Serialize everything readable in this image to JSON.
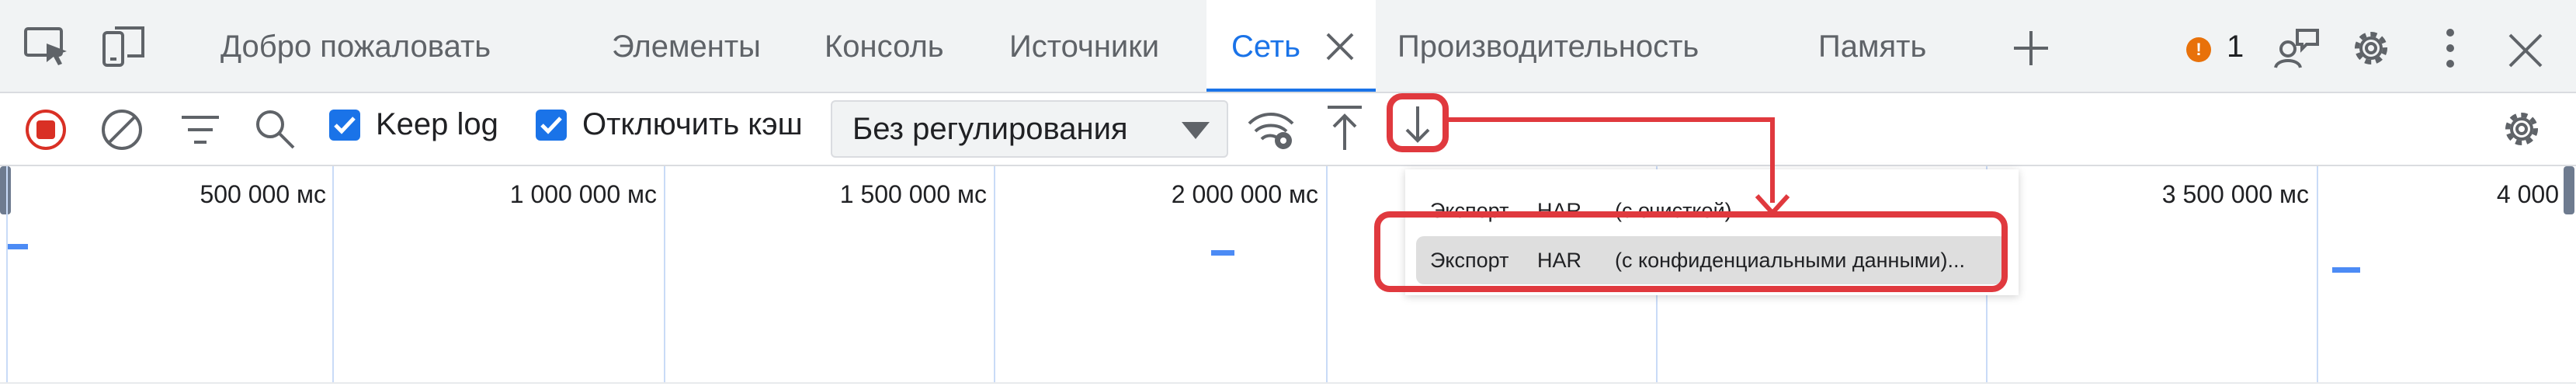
{
  "tabs": {
    "welcome": "Добро пожаловать",
    "elements": "Элементы",
    "console": "Консоль",
    "sources": "Источники",
    "network": "Сеть",
    "performance": "Производительность",
    "memory": "Память"
  },
  "issues": {
    "count": "1"
  },
  "toolbar": {
    "keep_log": "Keep log",
    "disable_cache": "Отключить кэш",
    "throttling": "Без регулирования"
  },
  "timeline": {
    "ticks": [
      "500 000 мс",
      "1 000 000 мс",
      "1 500 000 мс",
      "2 000 000 мс",
      "3 500 000 мс",
      "4 000"
    ]
  },
  "export_menu": {
    "item1": {
      "action": "Экспорт",
      "format": "HAR",
      "detail": "(с очисткой)..."
    },
    "item2": {
      "action": "Экспорт",
      "format": "HAR",
      "detail": "(с конфиденциальными данными)..."
    }
  },
  "colors": {
    "accent": "#1a73e8",
    "annotation": "#e0393e",
    "record": "#d93025",
    "issue_badge": "#e8710a"
  },
  "icons": {
    "inspect": "inspect-element-icon",
    "device": "device-toolbar-icon",
    "close_tab": "close-icon",
    "more_tabs": "plus-icon",
    "feedback": "feedback-icon",
    "settings": "gear-icon",
    "more": "kebab-menu-icon",
    "close_devtools": "close-icon",
    "record": "record-stop-icon",
    "clear": "clear-icon",
    "filter": "filter-icon",
    "search": "search-icon",
    "network_conditions": "wifi-gear-icon",
    "import": "upload-icon",
    "export": "download-icon",
    "network_settings": "gear-icon"
  }
}
